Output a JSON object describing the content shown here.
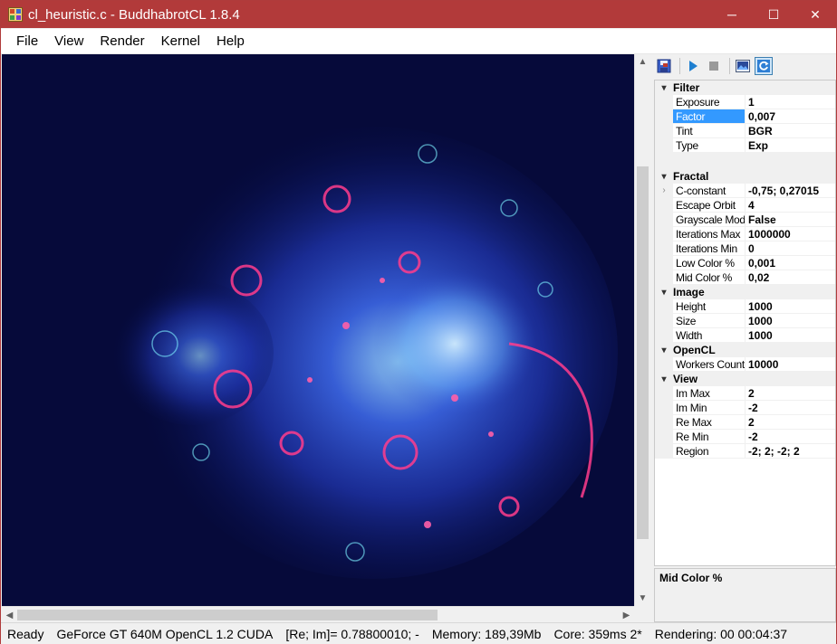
{
  "window": {
    "title": "cl_heuristic.c - BuddhabrotCL 1.8.4",
    "controls": {
      "minimize": "─",
      "maximize": "☐",
      "close": "✕"
    }
  },
  "menu": [
    "File",
    "View",
    "Render",
    "Kernel",
    "Help"
  ],
  "toolbar": {
    "icons": [
      "save-icon",
      "play-icon",
      "stop-icon",
      "image-icon",
      "refresh-icon"
    ]
  },
  "grid": {
    "filter": {
      "label": "Filter",
      "rows": [
        {
          "name": "Exposure",
          "value": "1"
        },
        {
          "name": "Factor",
          "value": "0,007"
        },
        {
          "name": "Tint",
          "value": "BGR"
        },
        {
          "name": "Type",
          "value": "Exp"
        }
      ]
    },
    "fractal": {
      "label": "Fractal",
      "rows": [
        {
          "name": "C-constant",
          "value": "-0,75; 0,27015"
        },
        {
          "name": "Escape Orbit",
          "value": "4"
        },
        {
          "name": "Grayscale Mode",
          "value": "False"
        },
        {
          "name": "Iterations Max",
          "value": "1000000"
        },
        {
          "name": "Iterations Min",
          "value": "0"
        },
        {
          "name": "Low Color %",
          "value": "0,001"
        },
        {
          "name": "Mid Color %",
          "value": "0,02"
        }
      ]
    },
    "image": {
      "label": "Image",
      "rows": [
        {
          "name": "Height",
          "value": "1000"
        },
        {
          "name": "Size",
          "value": "1000"
        },
        {
          "name": "Width",
          "value": "1000"
        }
      ]
    },
    "opencl": {
      "label": "OpenCL",
      "rows": [
        {
          "name": "Workers Count",
          "value": "10000"
        }
      ]
    },
    "view": {
      "label": "View",
      "rows": [
        {
          "name": "Im Max",
          "value": "2"
        },
        {
          "name": "Im Min",
          "value": "-2"
        },
        {
          "name": "Re Max",
          "value": "2"
        },
        {
          "name": "Re Min",
          "value": "-2"
        },
        {
          "name": "Region",
          "value": "-2; 2; -2; 2"
        }
      ]
    }
  },
  "description": {
    "title": "Mid Color %"
  },
  "status": {
    "state": "Ready",
    "device": "GeForce GT 640M OpenCL 1.2 CUDA",
    "coords": "[Re; Im]= 0.78800010; -",
    "memory": "Memory: 189,39Mb",
    "core": "Core: 359ms 2*",
    "rendering": "Rendering: 00 00:04:37"
  },
  "colors": {
    "titlebar": "#b23a3a",
    "canvas_bg": "#060a3a",
    "selection": "#3399ff"
  }
}
